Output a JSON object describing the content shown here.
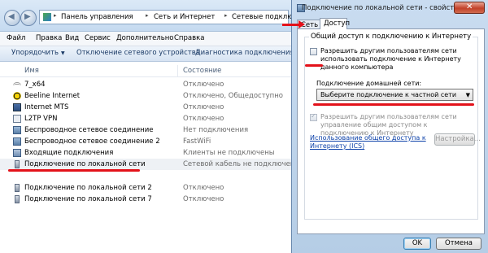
{
  "explorer": {
    "breadcrumbs": [
      "Панель управления",
      "Сеть и Интернет",
      "Сетевые подключения"
    ],
    "menu": [
      "Файл",
      "Правка",
      "Вид",
      "Сервис",
      "Дополнительно",
      "Справка"
    ],
    "toolbar": {
      "organize": "Упорядочить",
      "disconnect": "Отключение сетевого устройства",
      "diagnose": "Диагностика подключения"
    },
    "columns": {
      "name": "Имя",
      "status": "Состояние"
    },
    "connections": [
      {
        "name": "7_x64",
        "status": "Отключено"
      },
      {
        "name": "Beeline Internet",
        "status": "Отключено, Общедоступно"
      },
      {
        "name": "Internet MTS",
        "status": "Отключено"
      },
      {
        "name": "L2TP VPN",
        "status": "Отключено"
      },
      {
        "name": "Беспроводное сетевое соединение",
        "status": "Нет подключения"
      },
      {
        "name": "Беспроводное сетевое соединение 2",
        "status": "FastWiFi"
      },
      {
        "name": "Входящие подключения",
        "status": "Клиенты не подключены"
      },
      {
        "name": "Подключение по локальной сети",
        "status": "Сетевой кабель не подключен"
      },
      {
        "name": "Подключение по локальной сети 2",
        "status": "Отключено"
      },
      {
        "name": "Подключение по локальной сети 7",
        "status": "Отключено"
      }
    ]
  },
  "dialog": {
    "title": "Подключение по локальной сети - свойства",
    "close_label": "✕",
    "tabs": {
      "network": "Сеть",
      "access": "Доступ"
    },
    "group_title": "Общий доступ к подключению к Интернету",
    "allow_others": "Разрешить другим пользователям сети использовать подключение к Интернету данного компьютера",
    "home_network_label": "Подключение домашней сети:",
    "home_network_select": "Выберите подключение к частной сети",
    "allow_control": "Разрешить другим пользователям сети управление общим доступом к подключению к Интернету",
    "ics_link": "Использование общего доступа к Интернету (ICS)",
    "settings_button": "Настройка...",
    "ok_button": "OK",
    "cancel_button": "Отмена"
  }
}
